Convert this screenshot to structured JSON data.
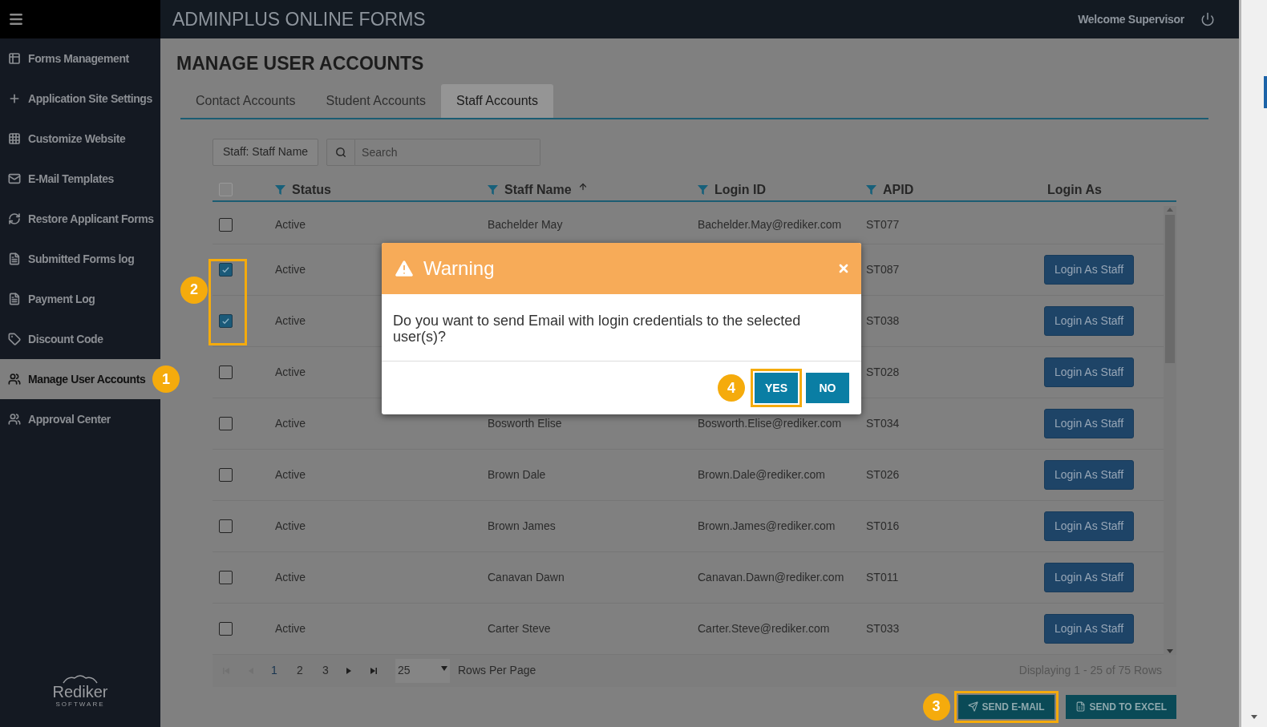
{
  "header": {
    "title": "ADMINPLUS ONLINE FORMS",
    "welcome": "Welcome Supervisor"
  },
  "sidebar": {
    "items": [
      {
        "label": "Forms Management",
        "selected": false
      },
      {
        "label": "Application Site Settings",
        "selected": false
      },
      {
        "label": "Customize Website",
        "selected": false
      },
      {
        "label": "E-Mail Templates",
        "selected": false
      },
      {
        "label": "Restore Applicant Forms",
        "selected": false
      },
      {
        "label": "Submitted Forms log",
        "selected": false
      },
      {
        "label": "Payment Log",
        "selected": false
      },
      {
        "label": "Discount Code",
        "selected": false
      },
      {
        "label": "Manage User Accounts",
        "selected": true,
        "callout": "1"
      },
      {
        "label": "Approval Center",
        "selected": false
      }
    ],
    "logo": {
      "name": "Rediker",
      "tagline": "SOFTWARE"
    }
  },
  "page_title": "MANAGE USER ACCOUNTS",
  "tabs": [
    {
      "label": "Contact Accounts",
      "selected": false
    },
    {
      "label": "Student Accounts",
      "selected": false
    },
    {
      "label": "Staff Accounts",
      "selected": true
    }
  ],
  "filter_button": "Staff: Staff Name",
  "search": {
    "placeholder": "Search"
  },
  "table": {
    "select_all": {
      "checked": false
    },
    "selection_callout": "2",
    "columns": [
      {
        "label": "Status",
        "filter": true,
        "sorted": false
      },
      {
        "label": "Staff Name",
        "filter": true,
        "sorted": true
      },
      {
        "label": "Login ID",
        "filter": true,
        "sorted": false
      },
      {
        "label": "APID",
        "filter": true,
        "sorted": false
      },
      {
        "label": "Login As",
        "filter": false,
        "sorted": false
      }
    ],
    "rows": [
      {
        "checked": false,
        "status": "Active",
        "staff_name": "Bachelder May",
        "login_id": "Bachelder.May@rediker.com",
        "apid": "ST077"
      },
      {
        "checked": true,
        "status": "Active",
        "apid": "ST087",
        "login_button": "Login As Staff"
      },
      {
        "checked": true,
        "status": "Active",
        "apid": "ST038",
        "login_button": "Login As Staff"
      },
      {
        "checked": false,
        "status": "Active",
        "apid": "ST028",
        "login_button": "Login As Staff"
      },
      {
        "checked": false,
        "status": "Active",
        "staff_name": "Bosworth Elise",
        "login_id": "Bosworth.Elise@rediker.com",
        "apid": "ST034",
        "login_button": "Login As Staff"
      },
      {
        "checked": false,
        "status": "Active",
        "staff_name": "Brown Dale",
        "login_id": "Brown.Dale@rediker.com",
        "apid": "ST026",
        "login_button": "Login As Staff"
      },
      {
        "checked": false,
        "status": "Active",
        "staff_name": "Brown James",
        "login_id": "Brown.James@rediker.com",
        "apid": "ST016",
        "login_button": "Login As Staff"
      },
      {
        "checked": false,
        "status": "Active",
        "staff_name": "Canavan Dawn",
        "login_id": "Canavan.Dawn@rediker.com",
        "apid": "ST011",
        "login_button": "Login As Staff"
      },
      {
        "checked": false,
        "status": "Active",
        "staff_name": "Carter Steve",
        "login_id": "Carter.Steve@rediker.com",
        "apid": "ST033",
        "login_button": "Login As Staff"
      }
    ]
  },
  "pager": {
    "pages": [
      {
        "label": "1",
        "selected": true
      },
      {
        "label": "2",
        "selected": false
      },
      {
        "label": "3",
        "selected": false
      }
    ],
    "page_size": "25",
    "page_size_label": "Rows Per Page",
    "summary": "Displaying 1 - 25 of 75 Rows"
  },
  "actions": [
    {
      "label": "SEND E-MAIL",
      "highlighted": true,
      "callout": "3"
    },
    {
      "label": "SEND TO EXCEL",
      "highlighted": false
    }
  ],
  "dialog": {
    "title": "Warning",
    "message": "Do you want to send Email with login credentials to the selected user(s)?",
    "buttons": [
      {
        "label": "YES",
        "highlighted": true,
        "callout": "4"
      },
      {
        "label": "NO",
        "highlighted": false
      }
    ]
  }
}
